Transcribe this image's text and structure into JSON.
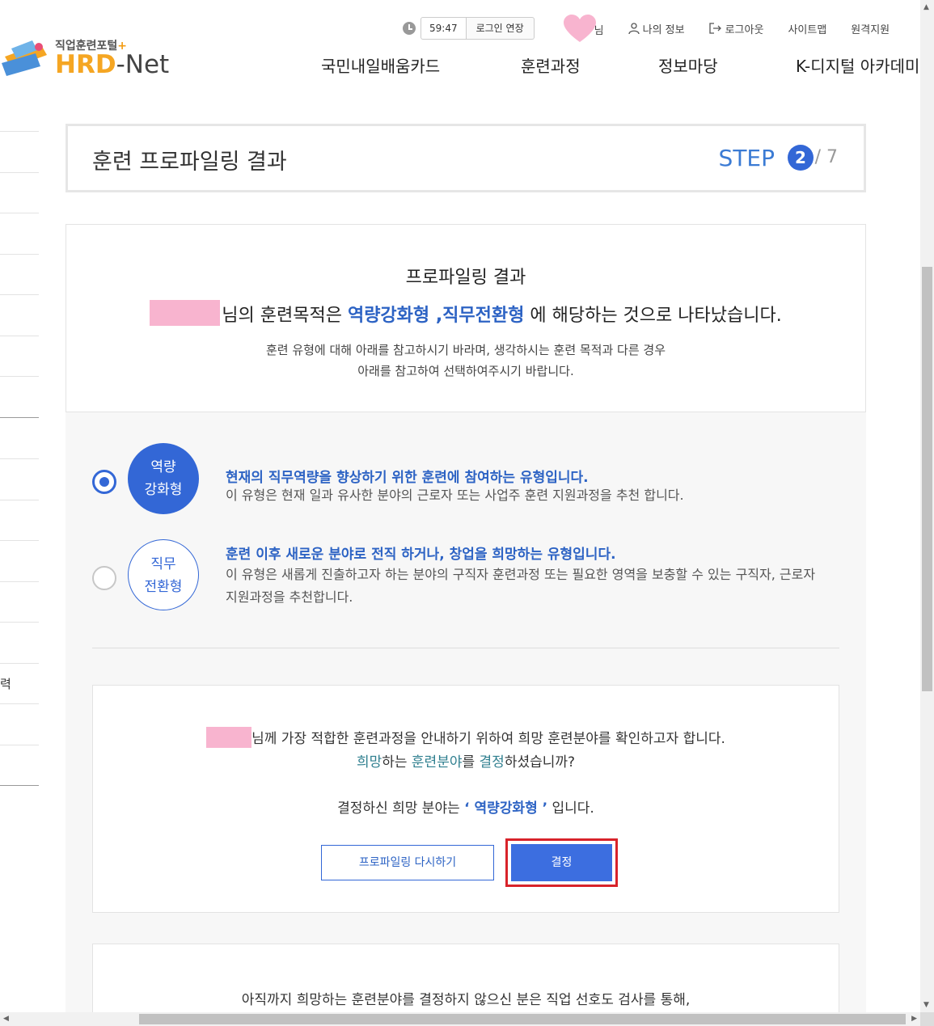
{
  "header": {
    "logo_sub": "직업훈련포털",
    "logo_plus": "+",
    "logo_hrd": "HRD",
    "logo_net": "-Net",
    "timer": "59:47",
    "extend_label": "로그인 연장",
    "user_suffix": "님",
    "my_info": "나의 정보",
    "logout": "로그아웃",
    "sitemap": "사이트맵",
    "remote_support": "원격지원",
    "nav": [
      "국민내일배움카드",
      "훈련과정",
      "정보마당",
      "K-디지털 아카데미"
    ]
  },
  "sidebar": {
    "partial_text": "력"
  },
  "step": {
    "title": "훈련 프로파일링 결과",
    "label": "STEP",
    "current": "2",
    "total": "/ 7"
  },
  "result": {
    "title": "프로파일링 결과",
    "line_prefix": "님의 훈련목적은",
    "line_types": "역량강화형 ,직무전환형",
    "line_suffix": "에 해당하는 것으로 나타났습니다.",
    "desc1": "훈련 유형에 대해 아래를 참고하시기 바라며, 생각하시는 훈련 목적과 다른 경우",
    "desc2": "아래를 참고하여 선택하여주시기 바랍니다."
  },
  "types": [
    {
      "badge_line1": "역량",
      "badge_line2": "강화형",
      "selected": true,
      "heading": "현재의 직무역량을 향상하기 위한 훈련에 참여하는 유형입니다.",
      "body": "이 유형은 현재 일과 유사한 분야의 근로자 또는 사업주 훈련 지원과정을 추천 합니다."
    },
    {
      "badge_line1": "직무",
      "badge_line2": "전환형",
      "selected": false,
      "heading": "훈련 이후 새로운 분야로 전직 하거나, 창업을 희망하는 유형입니다.",
      "body": "이 유형은 새롭게 진출하고자 하는 분야의 구직자 훈련과정 또는 필요한 영역을 보충할 수 있는 구직자, 근로자 지원과정을 추천합니다."
    }
  ],
  "confirm": {
    "line1": "님께 가장 적합한 훈련과정을 안내하기 위하여 희망 훈련분야를 확인하고자 합니다.",
    "q_w1": "희망",
    "q_t1": "하는 ",
    "q_w2": "훈련분야",
    "q_t2": "를 ",
    "q_w3": "결정",
    "q_t3": "하셨습니까?",
    "line3_prefix": "결정하신 희망 분야는",
    "line3_value": "‘ 역량강화형 ’",
    "line3_suffix": "입니다.",
    "retry_label": "프로파일링 다시하기",
    "decide_label": "결정"
  },
  "bottom": {
    "text": "아직까지 희망하는 훈련분야를 결정하지 않으신 분은 직업 선호도 검사를 통해,"
  },
  "colors": {
    "primary_blue": "#3367d6",
    "highlight_red": "#d8232a",
    "mask_pink": "#f8b4cf",
    "logo_orange": "#f5a623"
  }
}
